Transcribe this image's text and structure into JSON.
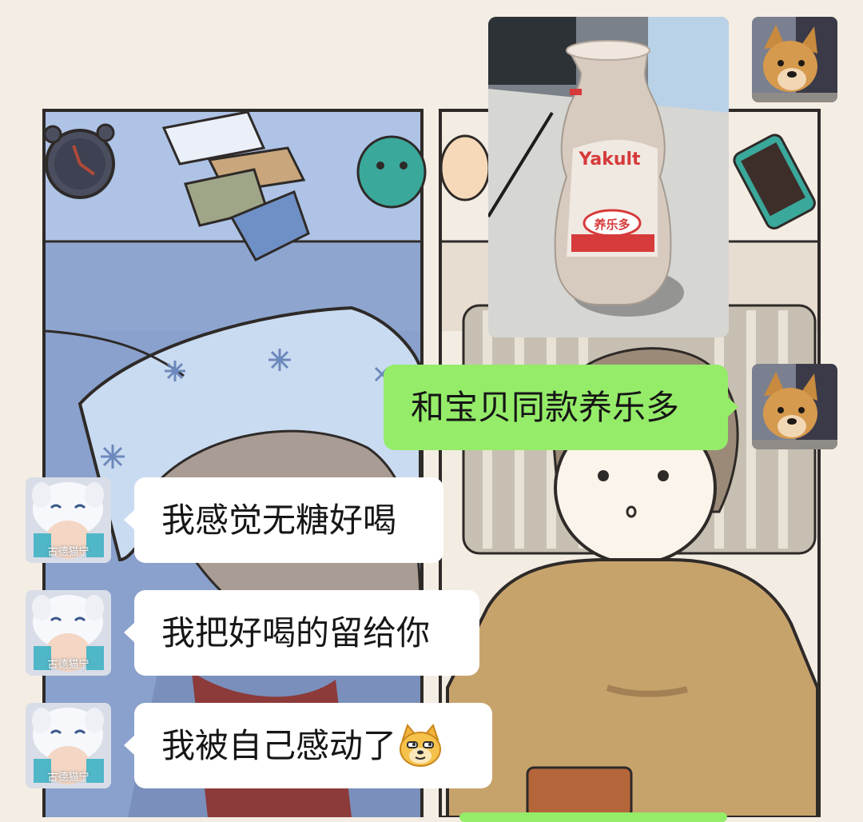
{
  "chat": {
    "messages": [
      {
        "side": "out",
        "type": "image",
        "image": {
          "brand": "Yakult",
          "label": "养乐多"
        }
      },
      {
        "side": "out",
        "type": "text",
        "text": "和宝贝同款养乐多"
      },
      {
        "side": "in",
        "type": "text",
        "text": "我感觉无糖好喝"
      },
      {
        "side": "in",
        "type": "text",
        "text": "我把好喝的留给你"
      },
      {
        "side": "in",
        "type": "text",
        "text": "我被自己感动了",
        "emoji": "doge-cat-emoji"
      }
    ],
    "self_avatar": {
      "icon": "dog-photo-avatar"
    },
    "peer_avatar": {
      "icon": "anime-cat-avatar",
      "caption": "古德猫宁"
    }
  },
  "colors": {
    "outgoing_bubble": "#95ec69",
    "incoming_bubble": "#ffffff",
    "background": "#f4ede3"
  }
}
